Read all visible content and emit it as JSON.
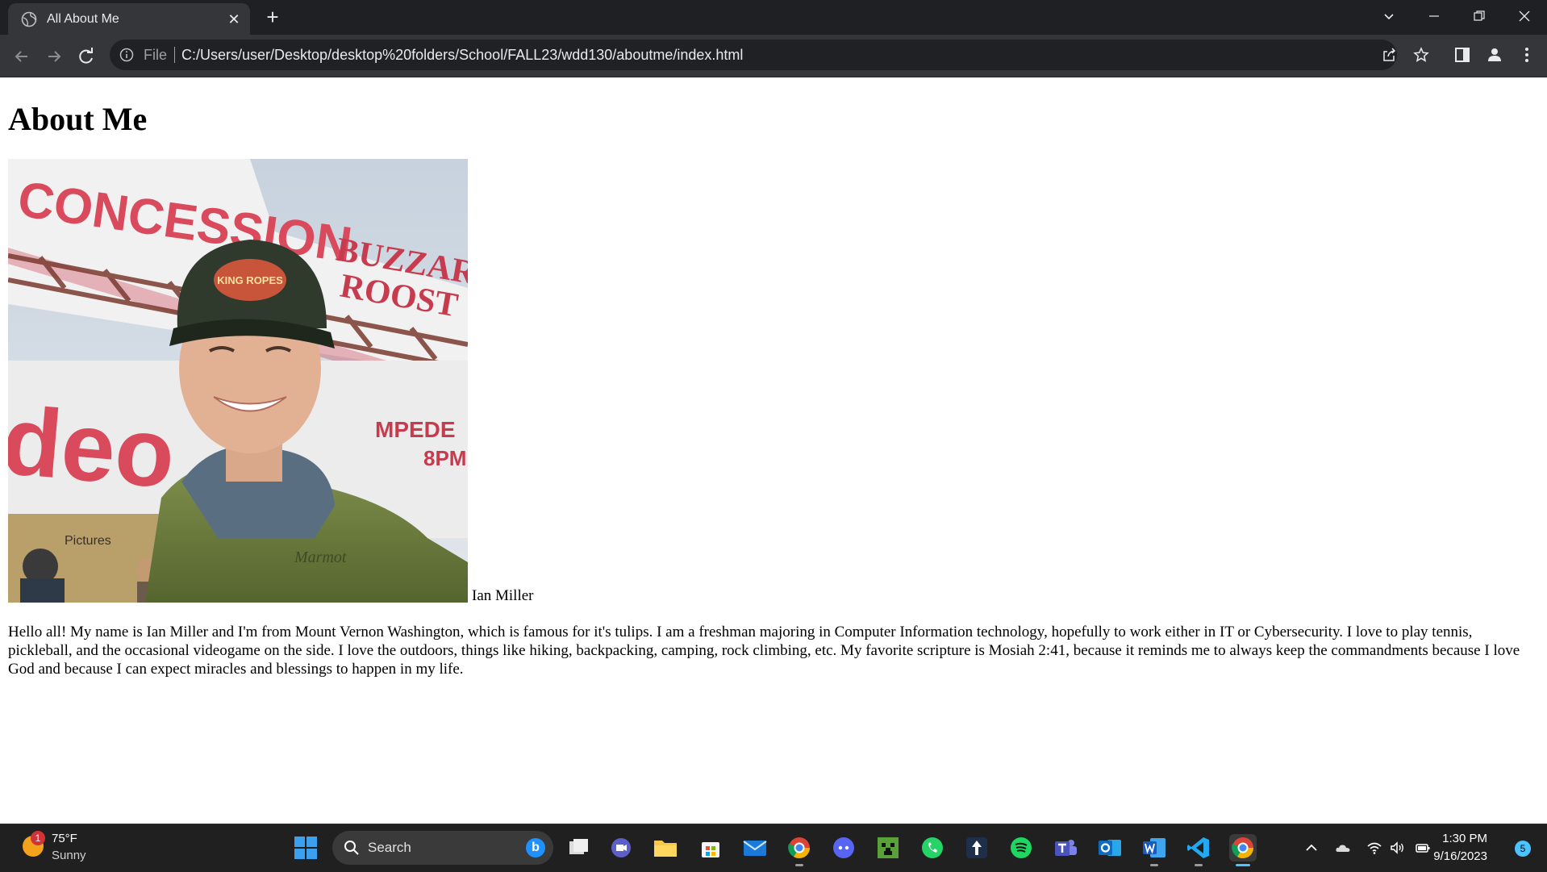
{
  "browser": {
    "tab_title": "All About Me",
    "new_tab": "+",
    "omnibox": {
      "file_label": "File",
      "url": "C:/Users/user/Desktop/desktop%20folders/School/FALL23/wdd130/aboutme/index.html"
    },
    "icons": [
      "back-icon",
      "forward-icon",
      "reload-icon",
      "info-icon",
      "share-icon",
      "star-icon",
      "side-panel-icon",
      "profile-icon",
      "menu-icon"
    ]
  },
  "page": {
    "heading": "About Me",
    "photo_sign_text": [
      "CONCESSION",
      "BUZZARDS",
      "ROOST",
      "deo",
      "MPEDE",
      "8PM",
      "Pictures",
      "KING ROPES",
      "Marmot"
    ],
    "caption": "Ian Miller",
    "bio": "Hello all! My name is Ian Miller and I'm from Mount Vernon Washington, which is famous for it's tulips. I am a freshman majoring in Computer Information technology, hopefully to work either in IT or Cybersecurity. I love to play tennis, pickleball, and the occasional videogame on the side. I love the outdoors, things like hiking, backpacking, camping, rock climbing, etc. My favorite scripture is Mosiah 2:41, because it reminds me to always keep the commandments because I love God and because I can expect miracles and blessings to happen in my life."
  },
  "taskbar": {
    "weather": {
      "temp": "75°F",
      "condition": "Sunny",
      "badge": "1"
    },
    "search_label": "Search",
    "apps": [
      "task-view",
      "meet",
      "file-explorer",
      "microsoft-store",
      "mail",
      "chrome-profile",
      "discord",
      "minecraft",
      "whatsapp",
      "app-arrow",
      "spotify",
      "teams",
      "outlook",
      "word",
      "vscode",
      "chrome"
    ],
    "clock": {
      "time": "1:30 PM",
      "date": "9/16/2023"
    },
    "notifications": "5"
  },
  "colors": {
    "chrome_dark": "#1f2023",
    "chrome_toolbar": "#35363a",
    "taskbar_bg": "#202020",
    "accent_blue": "#4cc2ff"
  }
}
